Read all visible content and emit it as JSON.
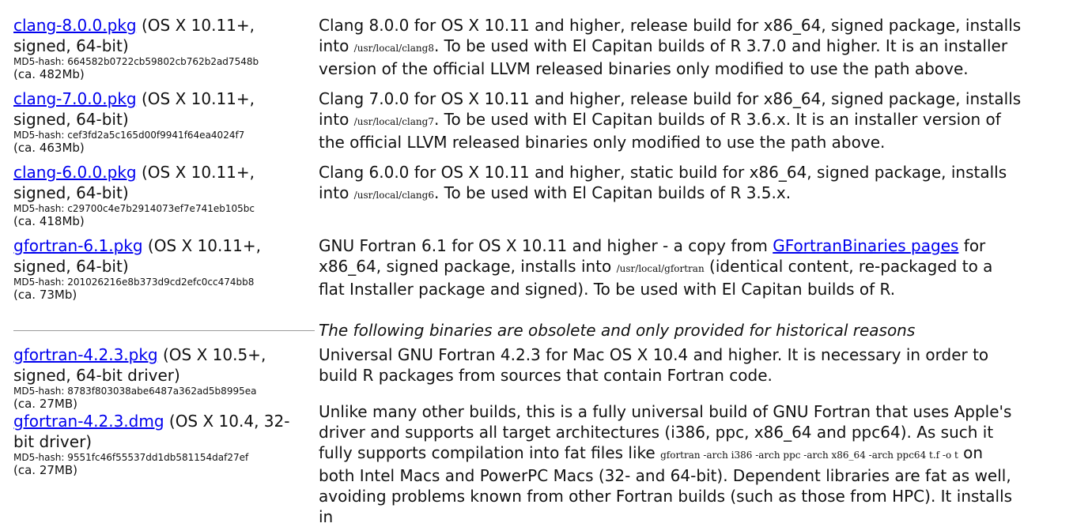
{
  "rows": [
    {
      "name": "clang-8.0.0.pkg",
      "meta": " (OS X 10.11+, signed, 64-bit)",
      "hash": "MD5-hash: 664582b0722cb59802cb762b2ad7548b",
      "size": "(ca. 482Mb)",
      "desc_pre": "Clang 8.0.0 for OS X 10.11 and higher, release build for x86_64, signed package, installs into ",
      "path": "/usr/local/clang8",
      "desc_post": ". To be used with El Capitan builds of R 3.7.0 and higher. It is an installer version of the official LLVM released binaries only modified to use the path above."
    },
    {
      "name": "clang-7.0.0.pkg",
      "meta": " (OS X 10.11+, signed, 64-bit)",
      "hash": "MD5-hash: cef3fd2a5c165d00f9941f64ea4024f7",
      "size": "(ca. 463Mb)",
      "desc_pre": "Clang 7.0.0 for OS X 10.11 and higher, release build for x86_64, signed package, installs into ",
      "path": "/usr/local/clang7",
      "desc_post": ". To be used with El Capitan builds of R 3.6.x. It is an installer version of the official LLVM released binaries only modified to use the path above."
    },
    {
      "name": "clang-6.0.0.pkg",
      "meta": " (OS X 10.11+, signed, 64-bit)",
      "hash": "MD5-hash: c29700c4e7b2914073ef7e741eb105bc",
      "size": "(ca. 418Mb)",
      "desc_pre": "Clang 6.0.0 for OS X 10.11 and higher, static build for x86_64, signed package, installs into ",
      "path": "/usr/local/clang6",
      "desc_post": ". To be used with El Capitan builds of R 3.5.x."
    },
    {
      "name": "gfortran-6.1.pkg",
      "meta": " (OS X 10.11+, signed, 64-bit)",
      "hash": "MD5-hash: 201026216e8b373d9cd2efc0cc474bb8",
      "size": "(ca. 73Mb)",
      "desc_pre": "GNU Fortran 6.1 for OS X 10.11 and higher - a copy from ",
      "link": "GFortranBinaries pages",
      "desc_mid": " for x86_64, signed package, installs into ",
      "path": "/usr/local/gfortran",
      "desc_post": " (identical content, re-packaged to a flat Installer package and signed). To be used with El Capitan builds of R."
    }
  ],
  "obsolete_heading": "The following binaries are obsolete and only provided for historical reasons",
  "obsolete": [
    {
      "name": "gfortran-4.2.3.pkg",
      "meta": " (OS X 10.5+, signed, 64-bit driver)",
      "hash": "MD5-hash: 8783f803038abe6487a362ad5b8995ea",
      "size": "(ca. 27MB)"
    },
    {
      "name": "gfortran-4.2.3.dmg",
      "meta": " (OS X 10.4, 32-bit driver)",
      "hash": "MD5-hash: 9551fc46f55537dd1db581154daf27ef",
      "size": "(ca. 27MB)"
    }
  ],
  "obsolete_desc": {
    "para1": "Universal GNU Fortran 4.2.3 for Mac OS X 10.4 and higher. It is necessary in order to build R packages from sources that contain Fortran code.",
    "para2_pre": "Unlike many other builds, this is a fully universal build of GNU Fortran that uses Apple's driver and supports all target architectures (i386, ppc, x86_64 and ppc64). As such it fully supports compilation into fat files like ",
    "para2_code": "gfortran -arch i386 -arch ppc -arch x86_64 -arch ppc64 t.f -o t",
    "para2_post": " on both Intel Macs and PowerPC Macs (32- and 64-bit). Dependent libraries are fat as well, avoiding problems known from other Fortran builds (such as those from HPC). It installs in"
  }
}
